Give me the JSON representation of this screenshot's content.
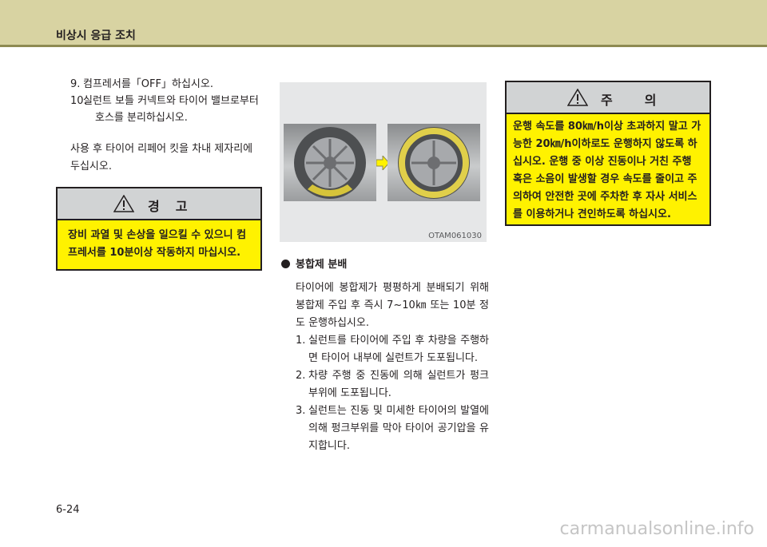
{
  "header": {
    "title": "비상시 응급 조치"
  },
  "left": {
    "steps": [
      {
        "num": "9.",
        "text": "컴프레서를「OFF」하십시오."
      },
      {
        "num": "10.",
        "text": "실런트 보틀 커넥트와 타이어 밸브로부터",
        "cont": "호스를 분리하십시오."
      }
    ],
    "para": "사용 후 타이어 리페어 킷을 차내 제자리에 두십시오."
  },
  "warning": {
    "title": "경고",
    "body": "장비 과열 및 손상을 일으킬 수 있으니 컴프레서를 10분이상 작동하지 마십시오."
  },
  "figure": {
    "code": "OTAM061030"
  },
  "mid": {
    "bullet_title": "봉합제 분배",
    "para": "타이어에 봉합제가 평평하게 분배되기 위해 봉합제 주입 후 즉시 7~10㎞ 또는 10분 정도 운행하십시오.",
    "steps": [
      {
        "num": "1.",
        "text": "실런트를 타이어에 주입 후 차량을 주행하면 타이어 내부에 실런트가 도포됩니다."
      },
      {
        "num": "2.",
        "text": "차량 주행 중 진동에 의해 실런트가 펑크 부위에 도포됩니다."
      },
      {
        "num": "3.",
        "text": "실런트는 진동 및 미세한 타이어의 발열에 의해 펑크부위를 막아 타이어 공기압을 유지합니다."
      }
    ]
  },
  "caution": {
    "title": "주의",
    "body": "운행 속도를 80㎞/h이상 초과하지 말고 가능한 20㎞/h이하로도 운행하지 않도록 하십시오. 운행 중 이상 진동이나 거친 주행 혹은 소음이 발생할 경우 속도를 줄이고 주의하여 안전한 곳에 주차한 후 자사 서비스를 이용하거나 견인하도록 하십시오."
  },
  "page_number": "6-24",
  "watermark": "carmanualsonline.info",
  "colors": {
    "header_band": "#d8d3a2",
    "header_rule": "#8e8a52",
    "box_fill": "#fff200",
    "box_header": "#d1d3d4"
  }
}
